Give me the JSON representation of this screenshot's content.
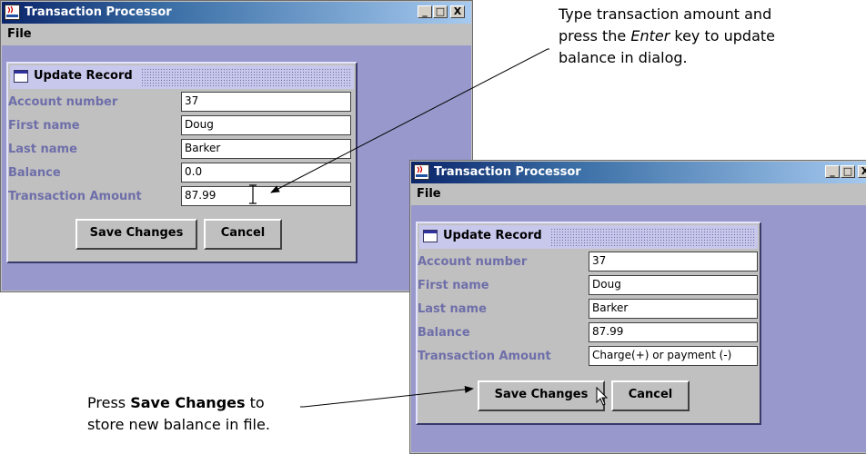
{
  "window_title": "Transaction Processor",
  "window_buttons": [
    "_",
    "□",
    "X"
  ],
  "menu_label": "File",
  "dialog_title": "Update Record",
  "labels": [
    "Account number",
    "First name",
    "Last name",
    "Balance",
    "Transaction Amount"
  ],
  "windows": [
    {
      "values": [
        "37",
        "Doug",
        "Barker",
        "0.0",
        "87.99"
      ]
    },
    {
      "values": [
        "37",
        "Doug",
        "Barker",
        "87.99",
        "Charge(+) or payment (-)"
      ]
    }
  ],
  "buttons": {
    "save": "Save Changes",
    "cancel": "Cancel"
  },
  "callout_top": {
    "line1": "Type transaction amount and",
    "line2_pre": "press the ",
    "line2_em": "Enter",
    "line2_post": " key to update",
    "line3": "balance in dialog."
  },
  "callout_bottom": {
    "line1_pre": "Press ",
    "line1_bold": "Save Changes",
    "line1_post": " to",
    "line2": "store new balance in file."
  },
  "colors": {
    "desktop": "#9898cc",
    "label": "#6e6eaa",
    "title_bar": "#0a246a"
  }
}
